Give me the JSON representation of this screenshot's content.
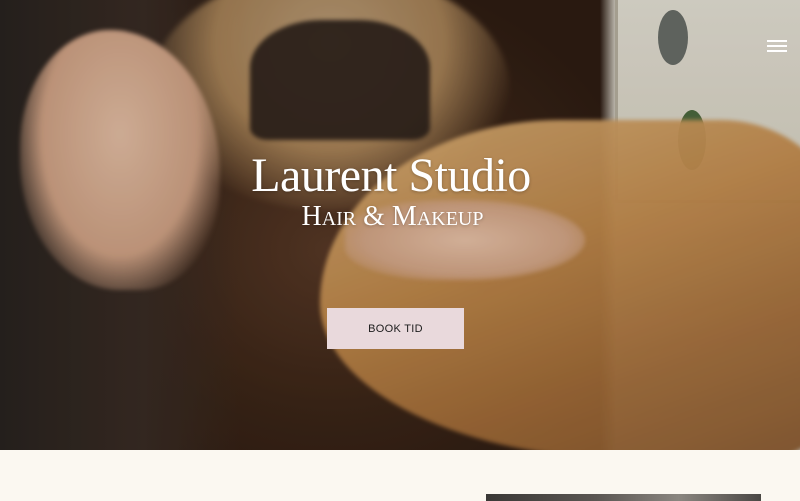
{
  "header": {
    "menu_icon": "hamburger-menu-icon"
  },
  "hero": {
    "title": "Laurent Studio",
    "subtitle": "Hair & Makeup",
    "cta_label": "BOOK TID"
  },
  "colors": {
    "cta_background": "#e9d9dc",
    "page_background": "#fbf8f1",
    "title_text": "#ffffff"
  }
}
